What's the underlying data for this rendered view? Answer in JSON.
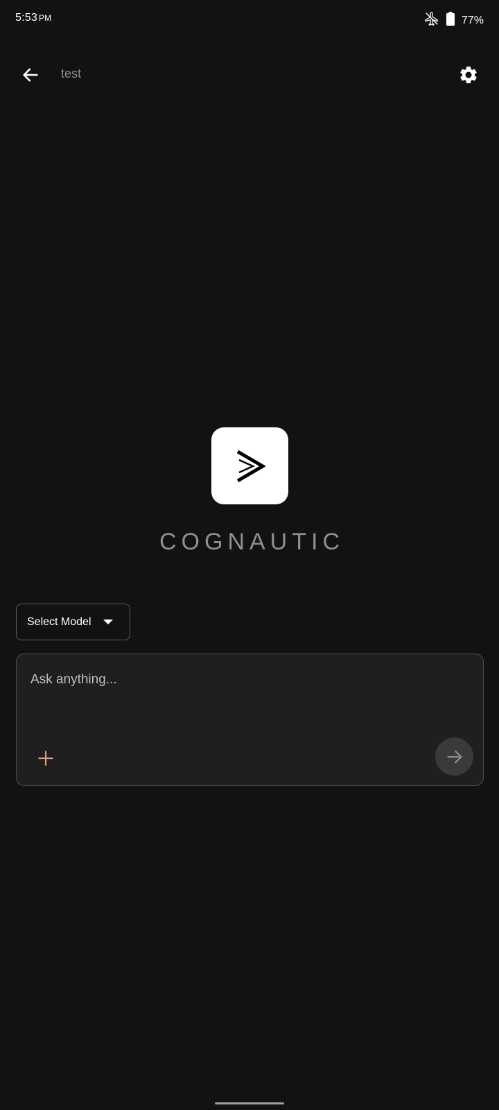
{
  "status_bar": {
    "time": "5:53",
    "ampm": "PM",
    "battery_percent": "77%",
    "icons": [
      "airplane-mode-icon",
      "battery-icon"
    ]
  },
  "app_bar": {
    "title": "test",
    "back_icon": "arrow-left-icon",
    "settings_icon": "gear-icon"
  },
  "brand": {
    "name": "COGNAUTIC",
    "logo_icon": "chevron-logo-icon"
  },
  "model_select": {
    "label": "Select Model",
    "icon": "caret-down-icon"
  },
  "chat_input": {
    "placeholder": "Ask anything...",
    "value": "",
    "add_icon": "plus-icon",
    "send_icon": "arrow-right-icon"
  },
  "colors": {
    "background": "#121212",
    "card": "#1f1f1f",
    "accent_plus": "#e0a080",
    "muted_text": "#8e8e8e"
  }
}
